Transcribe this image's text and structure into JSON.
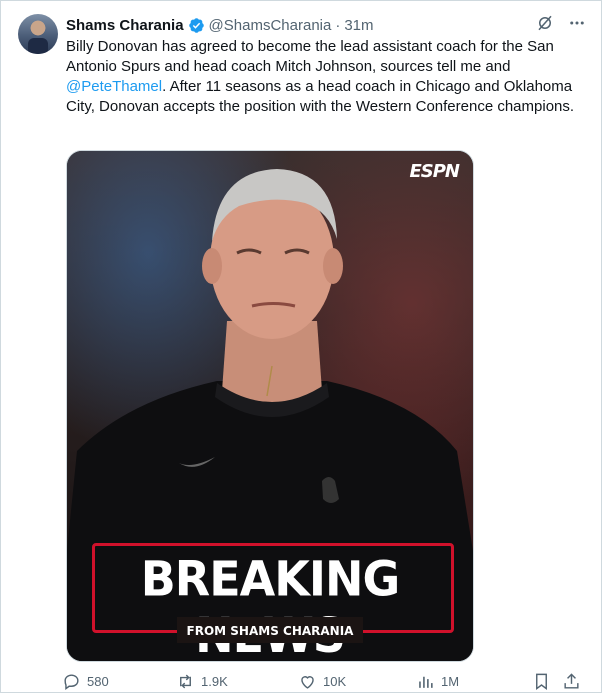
{
  "tweet": {
    "author_name": "Shams Charania",
    "handle": "@ShamsCharania",
    "separator": "·",
    "time": "31m",
    "text_before_mention": "Billy Donovan has agreed to become the lead assistant coach for the San Antonio Spurs and head coach Mitch Johnson, sources tell me and",
    "mention": "@PeteThamel",
    "text_after_mention": ". After 11 seasons as a head coach in Chicago and Oklahoma City, Donovan accepts the position with the Western Conference champions."
  },
  "media": {
    "logo": "ESPN",
    "headline": "BREAKING NEWS",
    "byline": "FROM SHAMS CHARANIA"
  },
  "actions": {
    "replies": "580",
    "reposts": "1.9K",
    "likes": "10K",
    "views": "1M"
  },
  "icons": {
    "verified": "verified-badge-icon",
    "grok": "grok-icon",
    "more": "more-icon",
    "reply": "reply-icon",
    "repost": "repost-icon",
    "like": "like-icon",
    "views": "views-icon",
    "bookmark": "bookmark-icon",
    "share": "share-icon"
  },
  "colors": {
    "accent": "#1d9bf0",
    "text": "#0f1419",
    "muted": "#536471",
    "breaking_red": "#d0112b"
  }
}
